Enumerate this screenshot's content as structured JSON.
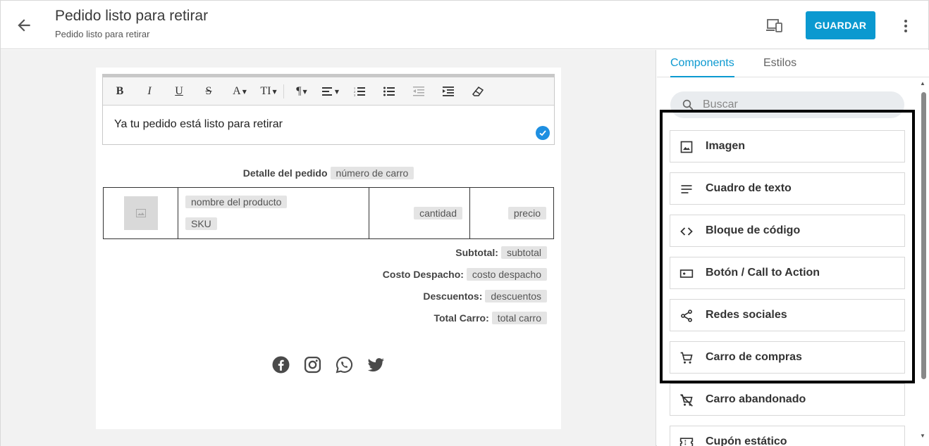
{
  "header": {
    "title": "Pedido listo para retirar",
    "subtitle": "Pedido listo para retirar",
    "back_icon": "arrow-left-icon",
    "device_icon": "devices-icon",
    "save_label": "GUARDAR",
    "more_icon": "more-vertical-icon",
    "accent_color": "#0b99d0"
  },
  "editor": {
    "toolbar": [
      {
        "name": "bold-button",
        "label": "B"
      },
      {
        "name": "italic-button",
        "label": "I"
      },
      {
        "name": "underline-button",
        "label": "U"
      },
      {
        "name": "strikethrough-button",
        "label": "S"
      },
      {
        "name": "font-color-button",
        "label": "A"
      },
      {
        "name": "font-size-button",
        "label": "TI"
      },
      {
        "name": "paragraph-button",
        "label": "¶"
      },
      {
        "name": "align-button",
        "icon": "align-left-icon"
      },
      {
        "name": "ordered-list-button",
        "icon": "ordered-list-icon"
      },
      {
        "name": "unordered-list-button",
        "icon": "unordered-list-icon"
      },
      {
        "name": "outdent-button",
        "icon": "outdent-icon"
      },
      {
        "name": "indent-button",
        "icon": "indent-icon"
      },
      {
        "name": "clear-format-button",
        "icon": "eraser-icon"
      }
    ],
    "text": "Ya tu pedido está listo para retirar"
  },
  "email": {
    "order_label": "Detalle del pedido",
    "order_tag": "número de carro",
    "product": {
      "name_tag": "nombre del producto",
      "sku_tag": "SKU",
      "quantity_tag": "cantidad",
      "price_tag": "precio"
    },
    "totals": [
      {
        "label": "Subtotal:",
        "tag": "subtotal"
      },
      {
        "label": "Costo Despacho:",
        "tag": "costo despacho"
      },
      {
        "label": "Descuentos:",
        "tag": "descuentos"
      },
      {
        "label": "Total Carro:",
        "tag": "total carro"
      }
    ],
    "social_icons": [
      "facebook-icon",
      "instagram-icon",
      "whatsapp-icon",
      "twitter-icon"
    ]
  },
  "panel": {
    "tabs": [
      {
        "label": "Components",
        "active": true
      },
      {
        "label": "Estilos",
        "active": false
      }
    ],
    "search_placeholder": "Buscar",
    "components": [
      {
        "label": "Imagen",
        "icon": "image-icon"
      },
      {
        "label": "Cuadro de texto",
        "icon": "text-lines-icon"
      },
      {
        "label": "Bloque de código",
        "icon": "code-icon"
      },
      {
        "label": "Botón / Call to Action",
        "icon": "button-icon"
      },
      {
        "label": "Redes sociales",
        "icon": "share-icon"
      },
      {
        "label": "Carro de compras",
        "icon": "cart-icon"
      },
      {
        "label": "Carro abandonado",
        "icon": "cart-off-icon"
      },
      {
        "label": "Cupón estático",
        "icon": "coupon-icon"
      }
    ]
  }
}
